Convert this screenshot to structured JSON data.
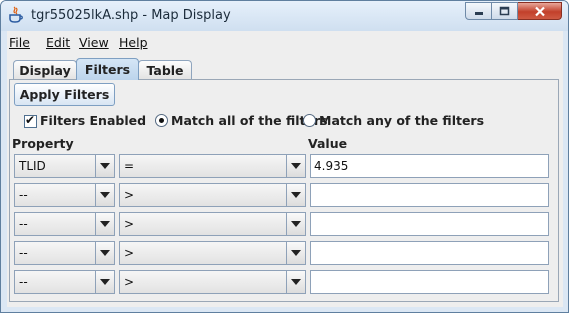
{
  "window": {
    "title": "tgr55025lkA.shp - Map Display"
  },
  "menu": [
    "File",
    "Edit",
    "View",
    "Help"
  ],
  "tabs": [
    "Display",
    "Filters",
    "Table"
  ],
  "selected_tab": "Filters",
  "filters": {
    "apply_label": "Apply Filters",
    "enabled_label": "Filters Enabled",
    "enabled": true,
    "match_all_label": "Match all of the filters",
    "match_any_label": "Match any of the filters",
    "match_mode": "all",
    "property_header": "Property",
    "value_header": "Value",
    "rows": [
      {
        "property": "TLID",
        "operator": "=",
        "value": "4.935"
      },
      {
        "property": "--",
        "operator": ">",
        "value": ""
      },
      {
        "property": "--",
        "operator": ">",
        "value": ""
      },
      {
        "property": "--",
        "operator": ">",
        "value": ""
      },
      {
        "property": "--",
        "operator": ">",
        "value": ""
      }
    ]
  }
}
